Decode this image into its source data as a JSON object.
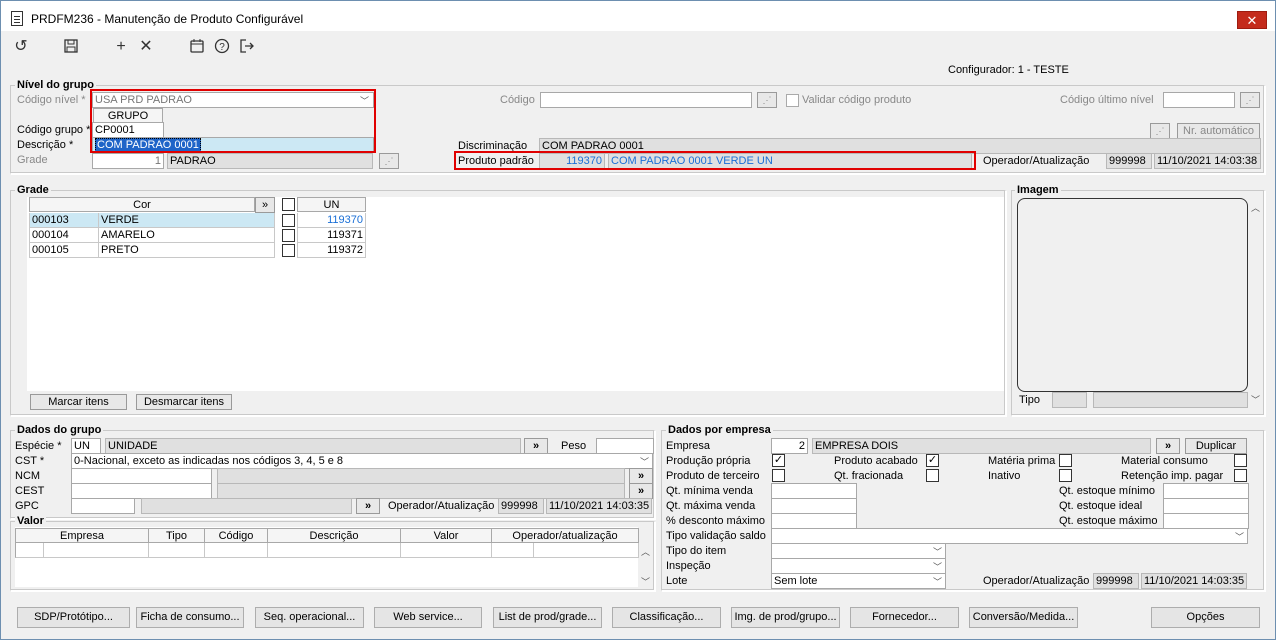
{
  "window": {
    "title": "PRDFM236 - Manutenção de Produto Configurável",
    "close": "✕"
  },
  "toolbar": {
    "refresh": "↺",
    "save": "💾",
    "add": "+",
    "delete": "✕",
    "calendar": "📅",
    "help": "?",
    "exit": "⇥"
  },
  "configurador": "Configurador: 1 - TESTE",
  "nivel": {
    "section": "Nível do grupo",
    "codigo_nivel_label": "Código nível *",
    "codigo_nivel_value": "USA PRD PADRAO",
    "dropdown_header": "GRUPO",
    "codigo_grupo_label": "Código grupo *",
    "codigo_grupo_value": "CP0001",
    "descricao_label": "Descrição *",
    "descricao_value": "COM PADRAO 0001",
    "grade_label": "Grade",
    "grade_num": "1",
    "grade_value": "PADRAO",
    "codigo_label": "Código",
    "validar_label": "Validar código produto",
    "codigo_ultimo_label": "Código último nível",
    "nr_automatico": "Nr. automático",
    "discriminacao_label": "Discriminação",
    "discriminacao_value": "COM PADRAO 0001",
    "produto_padrao_label": "Produto padrão",
    "produto_padrao_code": "119370",
    "produto_padrao_desc": "COM PADRAO 0001  VERDE UN",
    "operador_label": "Operador/Atualização",
    "operador_value": "999998",
    "operador_date": "11/10/2021 14:03:38"
  },
  "grade": {
    "section": "Grade",
    "col_cor": "Cor",
    "col_un": "UN",
    "expand": "»",
    "rows": [
      {
        "code": "000103",
        "name": "VERDE",
        "un": "119370"
      },
      {
        "code": "000104",
        "name": "AMARELO",
        "un": "119371"
      },
      {
        "code": "000105",
        "name": "PRETO",
        "un": "119372"
      }
    ],
    "marcar": "Marcar itens",
    "desmarcar": "Desmarcar itens"
  },
  "imagem": {
    "section": "Imagem",
    "tipo_label": "Tipo"
  },
  "dados_grupo": {
    "section": "Dados do grupo",
    "especie_label": "Espécie *",
    "especie_code": "UN",
    "especie_value": "UNIDADE",
    "peso_label": "Peso",
    "cst_label": "CST *",
    "cst_value": "0-Nacional, exceto as indicadas nos códigos 3, 4, 5 e 8",
    "ncm_label": "NCM",
    "cest_label": "CEST",
    "gpc_label": "GPC",
    "operador_label": "Operador/Atualização",
    "operador_value": "999998",
    "operador_date": "11/10/2021 14:03:35"
  },
  "valor": {
    "section": "Valor",
    "headers": [
      "Empresa",
      "Tipo",
      "Código",
      "Descrição",
      "Valor",
      "Operador/atualização"
    ]
  },
  "dados_empresa": {
    "section": "Dados por empresa",
    "empresa_label": "Empresa",
    "empresa_num": "2",
    "empresa_value": "EMPRESA DOIS",
    "duplicar": "Duplicar",
    "producao_propria": "Produção própria",
    "produto_acabado": "Produto acabado",
    "materia_prima": "Matéria prima",
    "material_consumo": "Material consumo",
    "produto_terceiro": "Produto de terceiro",
    "qt_fracionada": "Qt. fracionada",
    "inativo": "Inativo",
    "retencao": "Retenção imp. pagar",
    "qt_min_venda": "Qt. mínima venda",
    "qt_max_venda": "Qt. máxima venda",
    "desc_max": "% desconto máximo",
    "tipo_validacao": "Tipo validação saldo",
    "tipo_item": "Tipo do item",
    "inspecao": "Inspeção",
    "lote": "Lote",
    "lote_value": "Sem lote",
    "qt_estoque_min": "Qt. estoque mínimo",
    "qt_estoque_ideal": "Qt. estoque ideal",
    "qt_estoque_max": "Qt. estoque máximo",
    "operador_label": "Operador/Atualização",
    "operador_value": "999998",
    "operador_date": "11/10/2021 14:03:35"
  },
  "bottom_buttons": [
    "SDP/Protótipo...",
    "Ficha de consumo...",
    "Seq. operacional...",
    "Web service...",
    "List de prod/grade...",
    "Classificação...",
    "Img. de prod/grupo...",
    "Fornecedor...",
    "Conversão/Medida..."
  ],
  "opcoes": "Opções"
}
